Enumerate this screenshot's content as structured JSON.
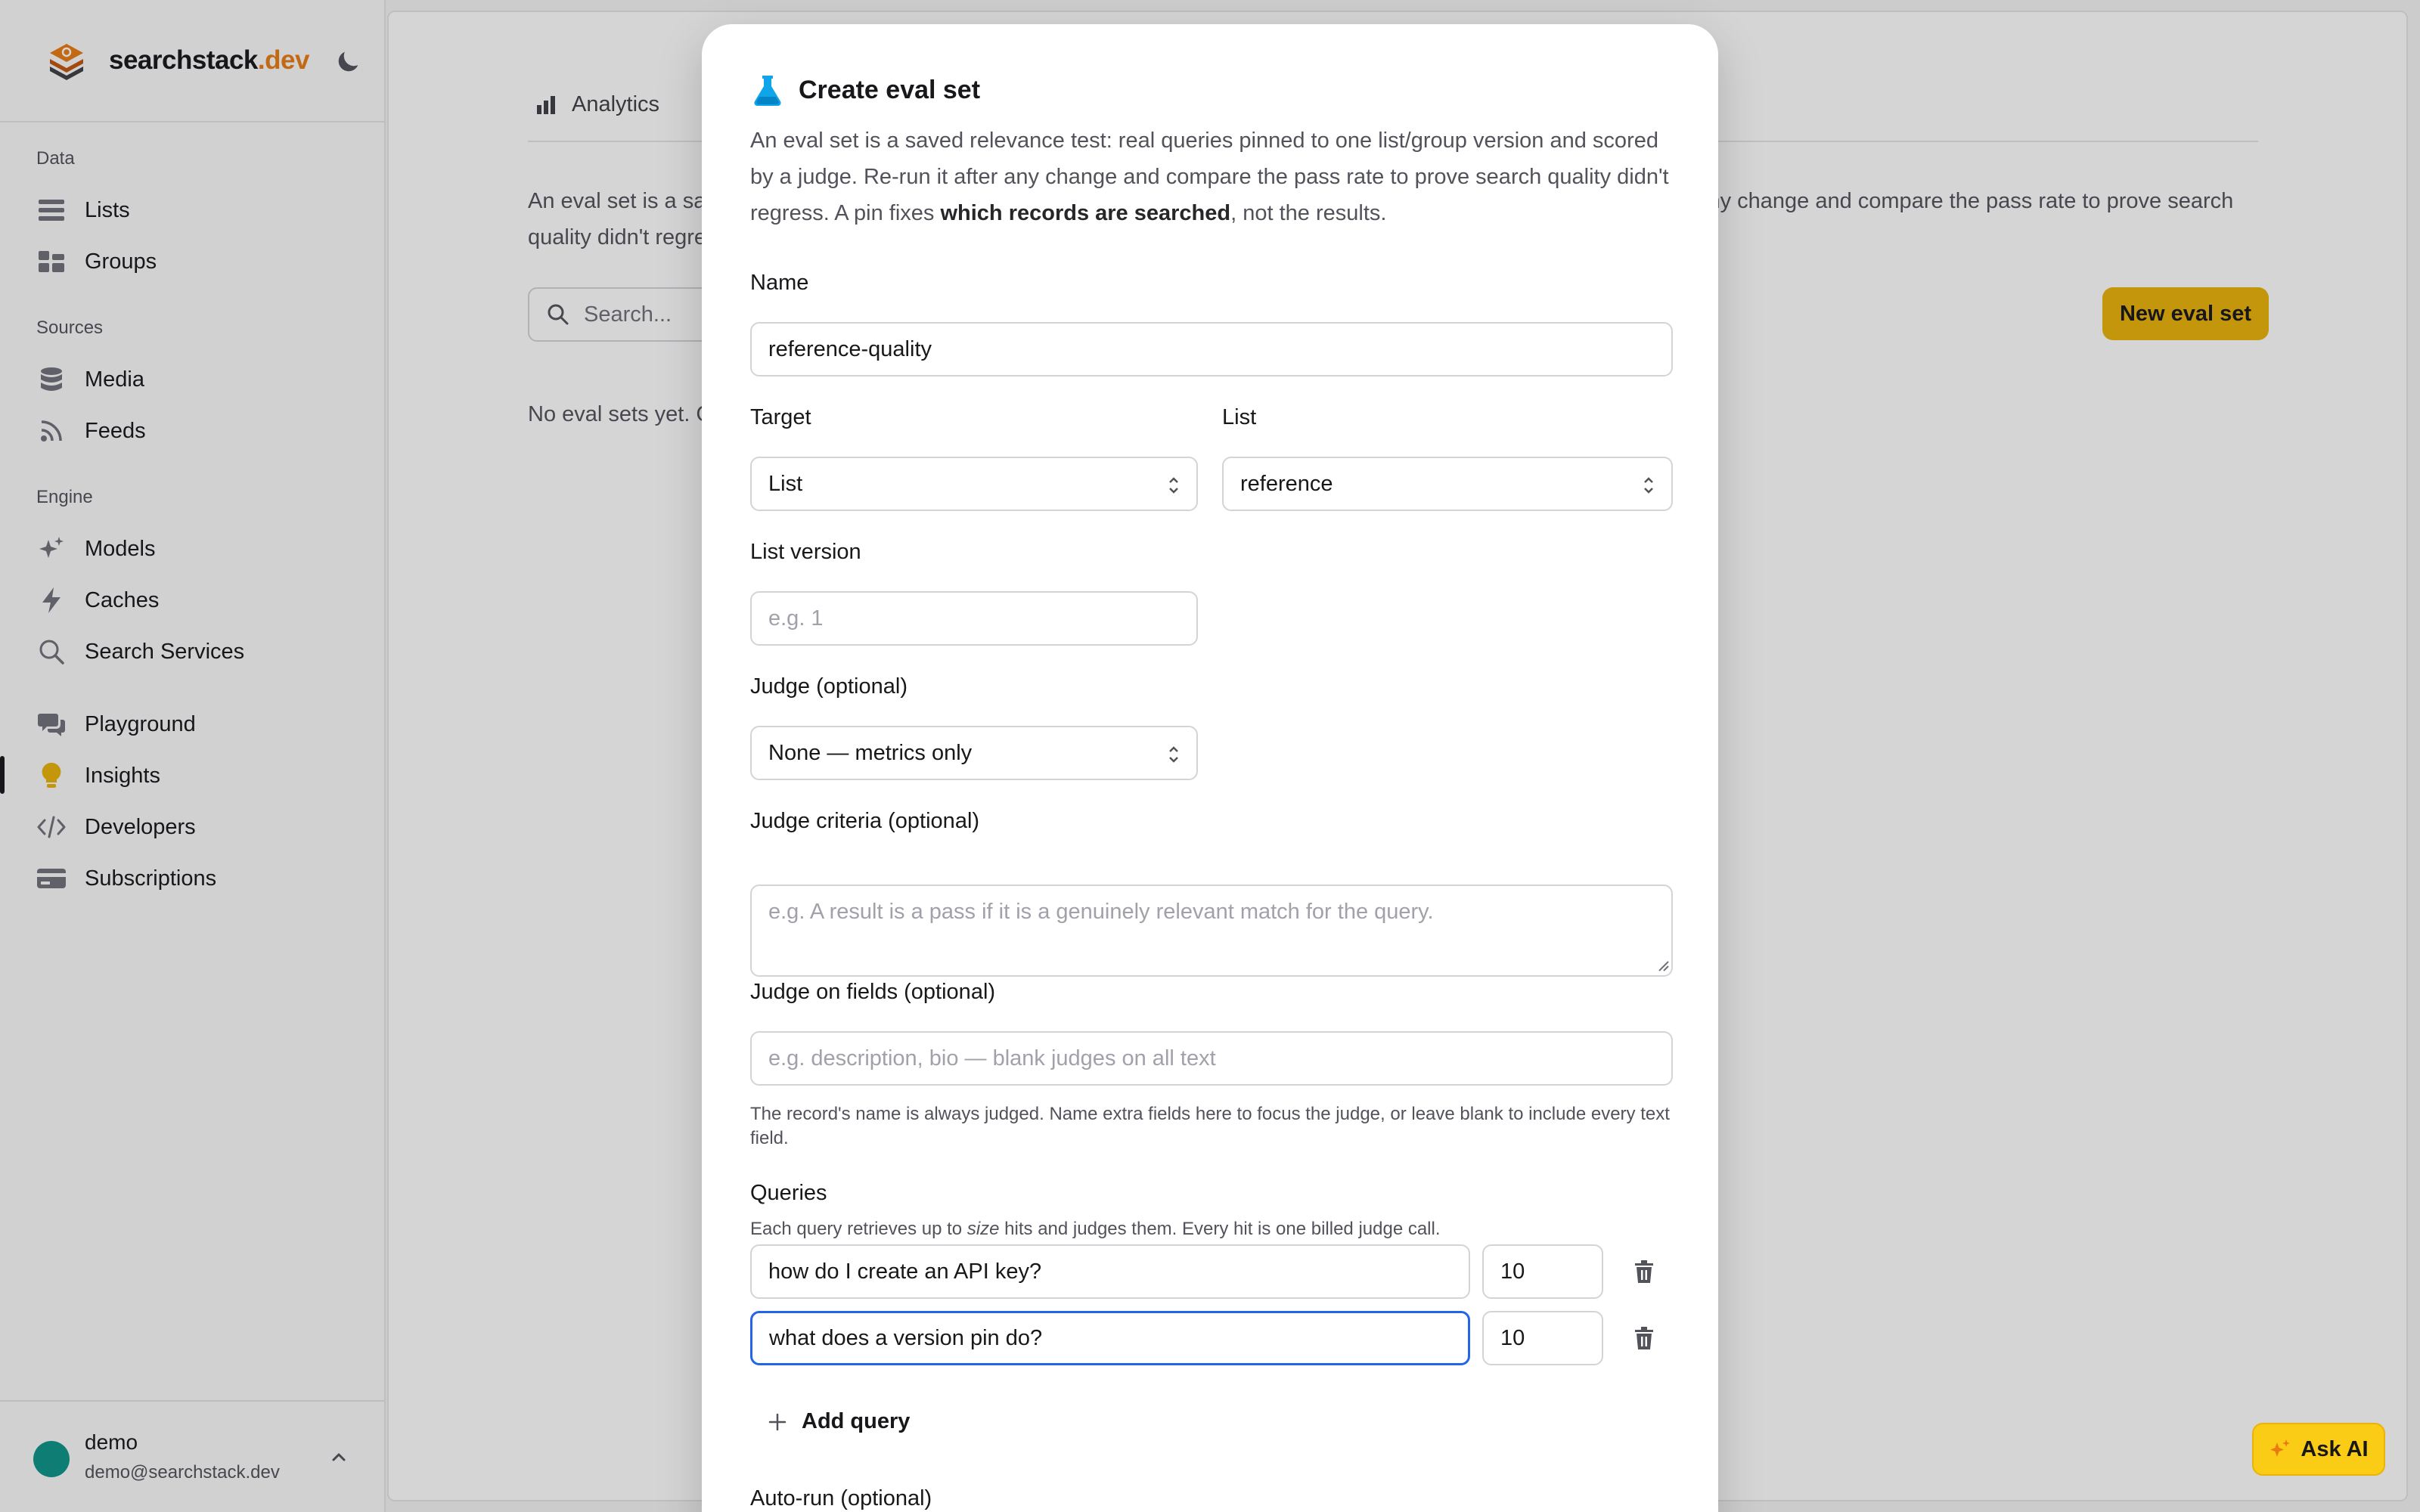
{
  "brand": {
    "name": "searchstack",
    "tld": ".dev"
  },
  "sidebar": {
    "sections": [
      {
        "label": "Data"
      },
      {
        "label": "Sources"
      },
      {
        "label": "Engine"
      }
    ],
    "items": [
      {
        "label": "Lists",
        "icon": "list-icon"
      },
      {
        "label": "Groups",
        "icon": "groups-icon"
      },
      {
        "label": "Media",
        "icon": "database-icon"
      },
      {
        "label": "Feeds",
        "icon": "rss-icon"
      },
      {
        "label": "Models",
        "icon": "sparkles-icon"
      },
      {
        "label": "Caches",
        "icon": "lightning-icon"
      },
      {
        "label": "Search Services",
        "icon": "search-icon"
      },
      {
        "label": "Playground",
        "icon": "chat-icon"
      },
      {
        "label": "Insights",
        "icon": "lightbulb-icon",
        "active": true
      },
      {
        "label": "Developers",
        "icon": "code-icon"
      },
      {
        "label": "Subscriptions",
        "icon": "card-icon"
      }
    ],
    "user": {
      "name": "demo",
      "email": "demo@searchstack.dev"
    }
  },
  "main": {
    "tab_label": "Analytics",
    "description": "An eval set is a saved relevance test: real queries pinned to one list/group version and scored by a judge. Re-run it after any change and compare the pass rate to prove search quality didn't regress.",
    "search_placeholder": "Search...",
    "new_button_label": "New eval set",
    "empty_text": "No eval sets yet. Create one to start tracking search quality."
  },
  "modal": {
    "title": "Create eval set",
    "description_main": "An eval set is a saved relevance test: real queries pinned to one list/group version and scored by a judge. Re-run it after any change and compare the pass rate to prove search quality didn't regress. A pin fixes ",
    "description_bold": "which records are searched",
    "description_end": ", not the results.",
    "name_label": "Name",
    "name_value": "reference-quality",
    "target_label": "Target",
    "target_value": "List",
    "list_label": "List",
    "list_value": "reference",
    "list_version_label": "List version",
    "list_version_placeholder": "e.g. 1",
    "judge_label": "Judge (optional)",
    "judge_value": "None — metrics only",
    "criteria_label": "Judge criteria (optional)",
    "criteria_placeholder": "e.g. A result is a pass if it is a genuinely relevant match for the query.",
    "fields_label": "Judge on fields (optional)",
    "fields_placeholder": "e.g. description, bio — blank judges on all text",
    "fields_help": "The record's name is always judged. Name extra fields here to focus the judge, or leave blank to include every text field.",
    "queries_label": "Queries",
    "queries_help_a": "Each query retrieves up to ",
    "queries_help_em": "size",
    "queries_help_b": " hits and judges them. Every hit is one billed judge call.",
    "queries": [
      {
        "text": "how do I create an API key?",
        "size": "10"
      },
      {
        "text": "what does a version pin do?",
        "size": "10"
      }
    ],
    "add_query_label": "Add query",
    "autorun_label": "Auto-run (optional)"
  },
  "ask_ai_label": "Ask AI",
  "colors": {
    "accent": "#eab308",
    "brand_tld": "#ea7a12",
    "focus": "#2563eb",
    "avatar": "#0d9488"
  }
}
